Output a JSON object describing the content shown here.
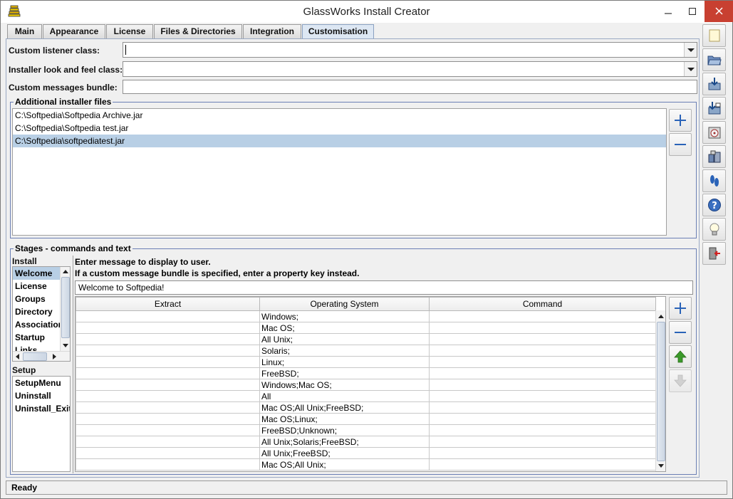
{
  "window": {
    "title": "GlassWorks Install Creator"
  },
  "tabs": [
    {
      "label": "Main"
    },
    {
      "label": "Appearance"
    },
    {
      "label": "License"
    },
    {
      "label": "Files & Directories"
    },
    {
      "label": "Integration"
    },
    {
      "label": "Customisation"
    }
  ],
  "form": {
    "listener_label": "Custom listener class:",
    "listener_value": "",
    "laf_label": "Installer look and feel class:",
    "laf_value": "",
    "bundle_label": "Custom messages bundle:",
    "bundle_value": ""
  },
  "additional_files": {
    "title": "Additional installer files",
    "items": [
      "C:\\Softpedia\\Softpedia Archive.jar",
      "C:\\Softpedia\\Softpedia test.jar",
      "C:\\Softpedia\\softpediatest.jar"
    ],
    "selected_index": 2
  },
  "stages": {
    "title": "Stages - commands and text",
    "install_label": "Install",
    "install_items": [
      "Welcome",
      "License",
      "Groups",
      "Directory",
      "Association",
      "Startup",
      "Links"
    ],
    "setup_label": "Setup",
    "setup_items": [
      "SetupMenu",
      "Uninstall",
      "Uninstall_Exit"
    ],
    "hint_line1": "Enter message to display to user.",
    "hint_line2": "If a custom message bundle is specified, enter a property key instead.",
    "message_value": "Welcome to Softpedia!",
    "columns": [
      "Extract",
      "Operating System",
      "Command"
    ],
    "rows": [
      [
        "",
        "Windows;",
        ""
      ],
      [
        "",
        "Mac OS;",
        ""
      ],
      [
        "",
        "All Unix;",
        ""
      ],
      [
        "",
        "Solaris;",
        ""
      ],
      [
        "",
        "Linux;",
        ""
      ],
      [
        "",
        "FreeBSD;",
        ""
      ],
      [
        "",
        "Windows;Mac OS;",
        ""
      ],
      [
        "",
        "All",
        ""
      ],
      [
        "",
        "Mac OS;All Unix;FreeBSD;",
        ""
      ],
      [
        "",
        "Mac OS;Linux;",
        ""
      ],
      [
        "",
        "FreeBSD;Unknown;",
        ""
      ],
      [
        "",
        "All Unix;Solaris;FreeBSD;",
        ""
      ],
      [
        "",
        "All Unix;FreeBSD;",
        ""
      ],
      [
        "",
        "Mac OS;All Unix;",
        ""
      ]
    ]
  },
  "status": {
    "text": "Ready"
  },
  "colors": {
    "selection": "#b8cfe5",
    "group_border": "#6b7fb5",
    "close_button": "#c84031",
    "add_icon": "#2a63b8",
    "move_up_icon": "#3a9a2a"
  },
  "icons": {
    "toolbar": [
      "new-file-icon",
      "open-folder-icon",
      "save-icon",
      "save-as-icon",
      "build-cd-icon",
      "package-icon",
      "foot-steps-icon",
      "help-icon",
      "tip-bulb-icon",
      "exit-door-icon"
    ]
  }
}
